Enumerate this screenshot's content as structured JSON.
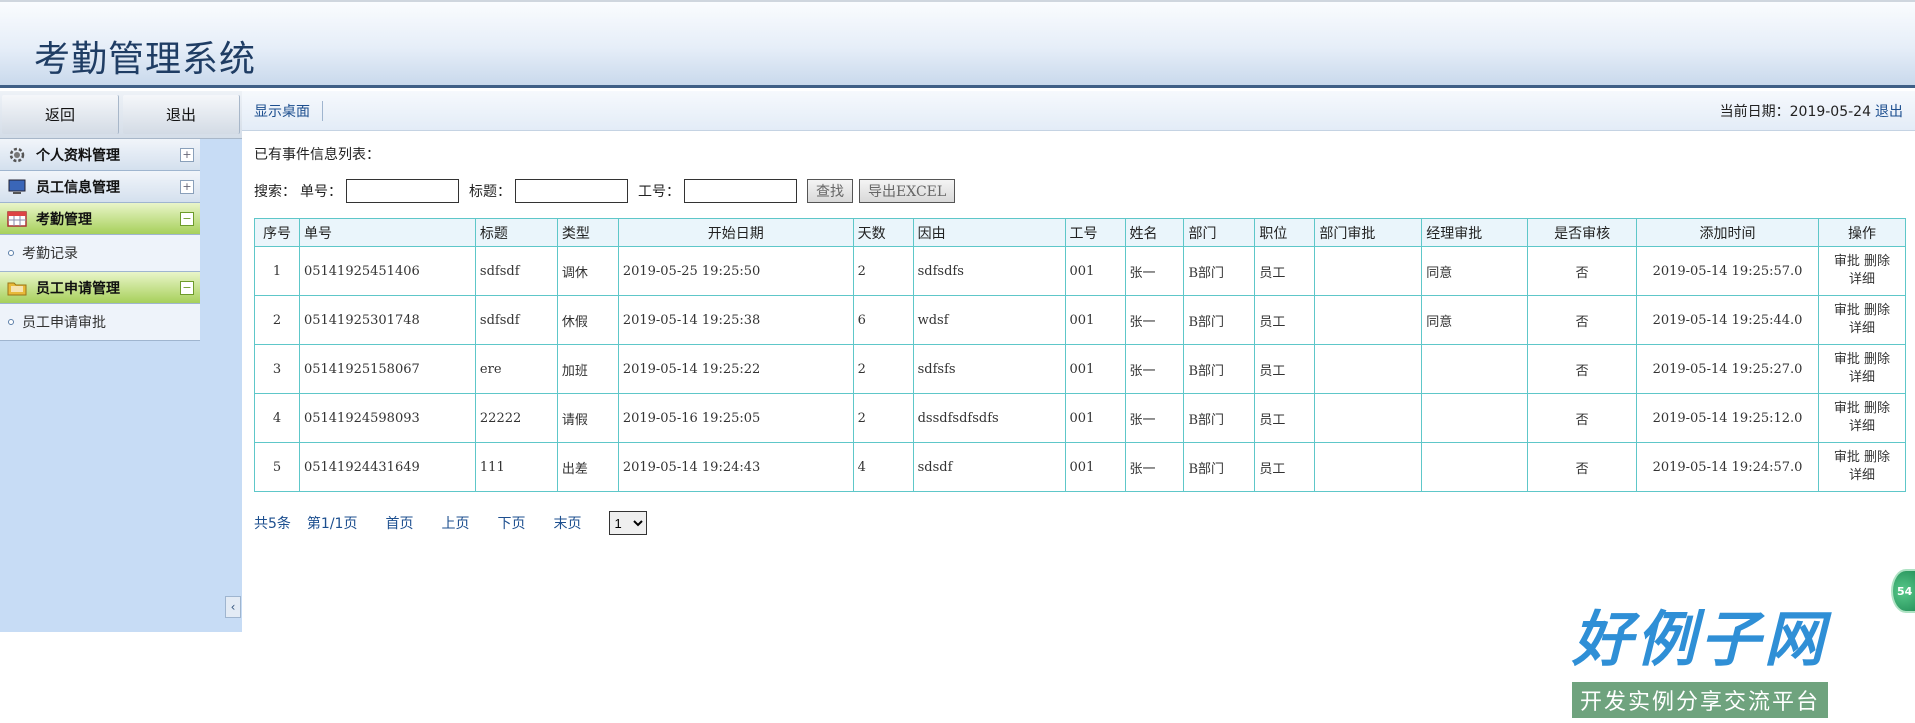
{
  "app": {
    "title": "考勤管理系统"
  },
  "sidebar": {
    "top_buttons": {
      "back": "返回",
      "exit": "退出"
    },
    "menus": [
      {
        "label": "个人资料管理",
        "icon": "gear-icon",
        "toggle": "+",
        "active": false,
        "items": []
      },
      {
        "label": "员工信息管理",
        "icon": "monitor-icon",
        "toggle": "+",
        "active": false,
        "items": []
      },
      {
        "label": "考勤管理",
        "icon": "calendar-icon",
        "toggle": "−",
        "active": true,
        "items": [
          {
            "label": "考勤记录"
          }
        ]
      },
      {
        "label": "员工申请管理",
        "icon": "folder-icon",
        "toggle": "−",
        "active": true,
        "items": [
          {
            "label": "员工申请审批"
          }
        ]
      }
    ],
    "collapse_glyph": "‹"
  },
  "topbar": {
    "desktop_link": "显示桌面",
    "date_label": "当前日期：2019-05-24",
    "logout": "退出"
  },
  "content": {
    "caption": "已有事件信息列表：",
    "search": {
      "prefix": "搜索：",
      "order_label": "单号：",
      "order_value": "",
      "title_label": "标题：",
      "title_value": "",
      "emp_label": "工号：",
      "emp_value": "",
      "search_button": "查找",
      "export_button": "导出EXCEL"
    },
    "table": {
      "headers": [
        "序号",
        "单号",
        "标题",
        "类型",
        "开始日期",
        "天数",
        "因由",
        "工号",
        "姓名",
        "部门",
        "职位",
        "部门审批",
        "经理审批",
        "是否审核",
        "添加时间",
        "操作"
      ],
      "rows": [
        {
          "idx": "1",
          "no": "05141925451406",
          "title": "sdfsdf",
          "type": "调休",
          "start": "2019-05-25 19:25:50",
          "days": "2",
          "reason": "sdfsdfs",
          "emp": "001",
          "name": "张一",
          "dept": "B部门",
          "pos": "员工",
          "dept_approve": "",
          "mgr_approve": "同意",
          "reviewed": "否",
          "added": "2019-05-14 19:25:57.0"
        },
        {
          "idx": "2",
          "no": "05141925301748",
          "title": "sdfsdf",
          "type": "休假",
          "start": "2019-05-14 19:25:38",
          "days": "6",
          "reason": "wdsf",
          "emp": "001",
          "name": "张一",
          "dept": "B部门",
          "pos": "员工",
          "dept_approve": "",
          "mgr_approve": "同意",
          "reviewed": "否",
          "added": "2019-05-14 19:25:44.0"
        },
        {
          "idx": "3",
          "no": "05141925158067",
          "title": "ere",
          "type": "加班",
          "start": "2019-05-14 19:25:22",
          "days": "2",
          "reason": "sdfsfs",
          "emp": "001",
          "name": "张一",
          "dept": "B部门",
          "pos": "员工",
          "dept_approve": "",
          "mgr_approve": "",
          "reviewed": "否",
          "added": "2019-05-14 19:25:27.0"
        },
        {
          "idx": "4",
          "no": "05141924598093",
          "title": "22222",
          "type": "请假",
          "start": "2019-05-16 19:25:05",
          "days": "2",
          "reason": "dssdfsdfsdfs",
          "emp": "001",
          "name": "张一",
          "dept": "B部门",
          "pos": "员工",
          "dept_approve": "",
          "mgr_approve": "",
          "reviewed": "否",
          "added": "2019-05-14 19:25:12.0"
        },
        {
          "idx": "5",
          "no": "05141924431649",
          "title": "111",
          "type": "出差",
          "start": "2019-05-14 19:24:43",
          "days": "4",
          "reason": "sdsdf",
          "emp": "001",
          "name": "张一",
          "dept": "B部门",
          "pos": "员工",
          "dept_approve": "",
          "mgr_approve": "",
          "reviewed": "否",
          "added": "2019-05-14 19:24:57.0"
        }
      ],
      "ops": {
        "approve": "审批",
        "delete": "删除",
        "detail": "详细"
      }
    },
    "pager": {
      "total": "共5条",
      "page_info": "第1/1页",
      "first": "首页",
      "prev": "上页",
      "next": "下页",
      "last": "末页",
      "page_select": "1"
    }
  },
  "watermark": {
    "title": "好例子网",
    "subtitle": "开发实例分享交流平台"
  },
  "badge": {
    "text": "54"
  }
}
